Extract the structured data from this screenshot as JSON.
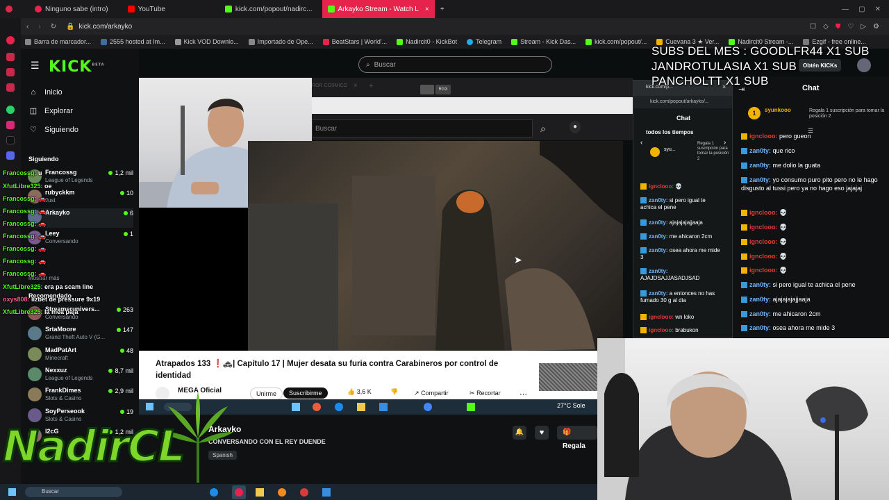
{
  "browser": {
    "tabs": [
      {
        "label": "Ninguno sabe (intro)",
        "active": false
      },
      {
        "label": "YouTube",
        "active": false
      },
      {
        "label": "kick.com/popout/nadirc...",
        "active": false
      },
      {
        "label": "Arkayko Stream - Watch L",
        "active": true
      }
    ],
    "url": "kick.com/arkayko",
    "bookmarks": [
      "Barra de marcador...",
      "2555 hosted at Im...",
      "Kick VOD Downlo...",
      "Importado de Ope...",
      "BeatStars | World'...",
      "Nadircit0 - KickBot",
      "Telegram",
      "Stream - Kick Das...",
      "kick.com/popout/...",
      "Cuevana 3 ★ Ver...",
      "Nadircit0 Stream -...",
      "Ezgif - free online..."
    ]
  },
  "kick": {
    "logo": "KICK",
    "beta": "BETA",
    "search_placeholder": "Buscar",
    "nav": [
      {
        "label": "Inicio",
        "icon": "home-icon"
      },
      {
        "label": "Explorar",
        "icon": "compass-icon"
      },
      {
        "label": "Siguiendo",
        "icon": "heart-icon"
      }
    ],
    "following_title": "Siguiendo",
    "following": [
      {
        "name": "Francossg",
        "category": "League of Legends",
        "viewers": "1,2 mil",
        "color": "#6b8c5a"
      },
      {
        "name": "rubyckkm",
        "category": "Just",
        "viewers": "10",
        "color": "#8a6c5a"
      },
      {
        "name": "Arkayko",
        "category": "",
        "viewers": "6",
        "color": "#5a6c8a"
      },
      {
        "name": "Leey",
        "category": "Conversando",
        "viewers": "1",
        "color": "#7a5a8a"
      }
    ],
    "show_more": "Mostrar más",
    "recommended_title": "Recomendado",
    "recommended": [
      {
        "name": "Streamerunivers...",
        "category": "Conversando",
        "viewers": "263",
        "color": "#8a5a5a"
      },
      {
        "name": "SrtaMoore",
        "category": "Grand Theft Auto V (G...",
        "viewers": "147",
        "color": "#5a7a8a"
      },
      {
        "name": "MadPatArt",
        "category": "Minecraft",
        "viewers": "48",
        "color": "#7a8a5a"
      },
      {
        "name": "Nexxuz",
        "category": "League of Legends",
        "viewers": "8,7 mil",
        "color": "#5a8a6a"
      },
      {
        "name": "FrankDimes",
        "category": "Slots & Casino",
        "viewers": "2,9 mil",
        "color": "#8a7a5a"
      },
      {
        "name": "SoyPerseook",
        "category": "Slots & Casino",
        "viewers": "19",
        "color": "#6a5a8a"
      },
      {
        "name": "I2cG",
        "category": "",
        "viewers": "1,2 mil",
        "color": "#8a6a6a"
      }
    ],
    "get_kicks": "Obtén KICKs",
    "chat_title": "Chat"
  },
  "chat_overlay": [
    {
      "user": "Francossg:",
      "text": "u"
    },
    {
      "user": "XfutLibre325:",
      "text": "oe"
    },
    {
      "user": "Francossg:",
      "text": "🚗"
    },
    {
      "user": "Francossg:",
      "text": "🚗"
    },
    {
      "user": "Francossg:",
      "text": "🚗"
    },
    {
      "user": "Francossg:",
      "text": "🚗"
    },
    {
      "user": "Francossg:",
      "text": "🚗"
    },
    {
      "user": "Francossg:",
      "text": "🚗"
    },
    {
      "user": "Francossg:",
      "text": "🚗"
    },
    {
      "user": "XfutLibre325:",
      "text": "era pa scam line"
    },
    {
      "user": "oxys808:",
      "text": "lizbet de pressure 9x19"
    },
    {
      "user": "XfutLibre325:",
      "text": "la mea paja"
    }
  ],
  "youtube": {
    "search_placeholder": "Buscar",
    "tab_label": "ROR COSMICO",
    "video_title": "Atrapados 133 ❗🚓| Capítulo 17 | Mujer desata su furia contra Carabineros por control de identidad",
    "channel": "MEGA Oficial",
    "join": "Unirme",
    "subscribe": "Suscribirme",
    "likes": "3,6 K",
    "share": "Compartir",
    "clip": "Recortar",
    "weather": "27°C Sole"
  },
  "stream_info": {
    "name": "Arkayko",
    "title": "CONVERSANDO CON EL REY DUENDE",
    "language": "Spanish",
    "gift": "Regala"
  },
  "popout_chat": {
    "url": "kick.com/popout/arkayko/...",
    "title": "Chat",
    "top_label": "todos los tiempos",
    "pinned_user": "syu...",
    "pinned_text": "Regala 1 suscripción para tomar la posición 2",
    "messages": [
      {
        "user": "ignclooo:",
        "text": "💀",
        "red": true
      },
      {
        "user": "zan0ty:",
        "text": "si pero igual te achica el pene",
        "red": false
      },
      {
        "user": "zan0ty:",
        "text": "ajajajajajjaaja",
        "red": false
      },
      {
        "user": "zan0ty:",
        "text": "me ahicaron 2cm",
        "red": false
      },
      {
        "user": "zan0ty:",
        "text": "osea ahora me mide 3",
        "red": false
      },
      {
        "user": "zan0ty:",
        "text": "AJAJDSAJJASADJSAD",
        "red": false
      },
      {
        "user": "zan0ty:",
        "text": "a entonces no has fumado 30 g al dia",
        "red": false
      },
      {
        "user": "ignclooo:",
        "text": "wn loko",
        "red": true
      },
      {
        "user": "ignclooo:",
        "text": "brabukon",
        "red": true
      }
    ]
  },
  "main_chat": {
    "pinned_user": "syunkooo",
    "pinned_text": "Regala 1 suscripción para tomar la posición 2",
    "messages": [
      {
        "user": "ignclooo:",
        "text": "pero gueon",
        "red": true
      },
      {
        "user": "zan0ty:",
        "text": "que rico",
        "red": false
      },
      {
        "user": "zan0ty:",
        "text": "me dolio la guata",
        "red": false
      },
      {
        "user": "zan0ty:",
        "text": "yo consumo puro pito pero no le hago disgusto al tussi pero ya no hago eso jajajaj",
        "red": false
      },
      {
        "user": "ignclooo:",
        "text": "💀",
        "red": true
      },
      {
        "user": "ignclooo:",
        "text": "💀",
        "red": true
      },
      {
        "user": "ignclooo:",
        "text": "💀",
        "red": true
      },
      {
        "user": "ignclooo:",
        "text": "💀",
        "red": true
      },
      {
        "user": "ignclooo:",
        "text": "💀",
        "red": true
      },
      {
        "user": "zan0ty:",
        "text": "si pero igual te achica el pene",
        "red": false
      },
      {
        "user": "zan0ty:",
        "text": "ajajajajajjaaja",
        "red": false
      },
      {
        "user": "zan0ty:",
        "text": "me ahicaron 2cm",
        "red": false
      },
      {
        "user": "zan0ty:",
        "text": "osea ahora me mide 3",
        "red": false
      }
    ]
  },
  "subs_overlay": [
    "SUBS DEL MES : GOODLFR44 X1 SUB",
    "JANDROTULASIA X1 SUB",
    "PANCHOLTT X1 SUB"
  ],
  "streamer_logo": "NadirCL",
  "taskbar_search": "Buscar",
  "colors": {
    "kick_green": "#53fc18",
    "tab_active": "#e6234a",
    "chat_user": "#6fb6ff",
    "chat_user_red": "#e23b3b"
  }
}
